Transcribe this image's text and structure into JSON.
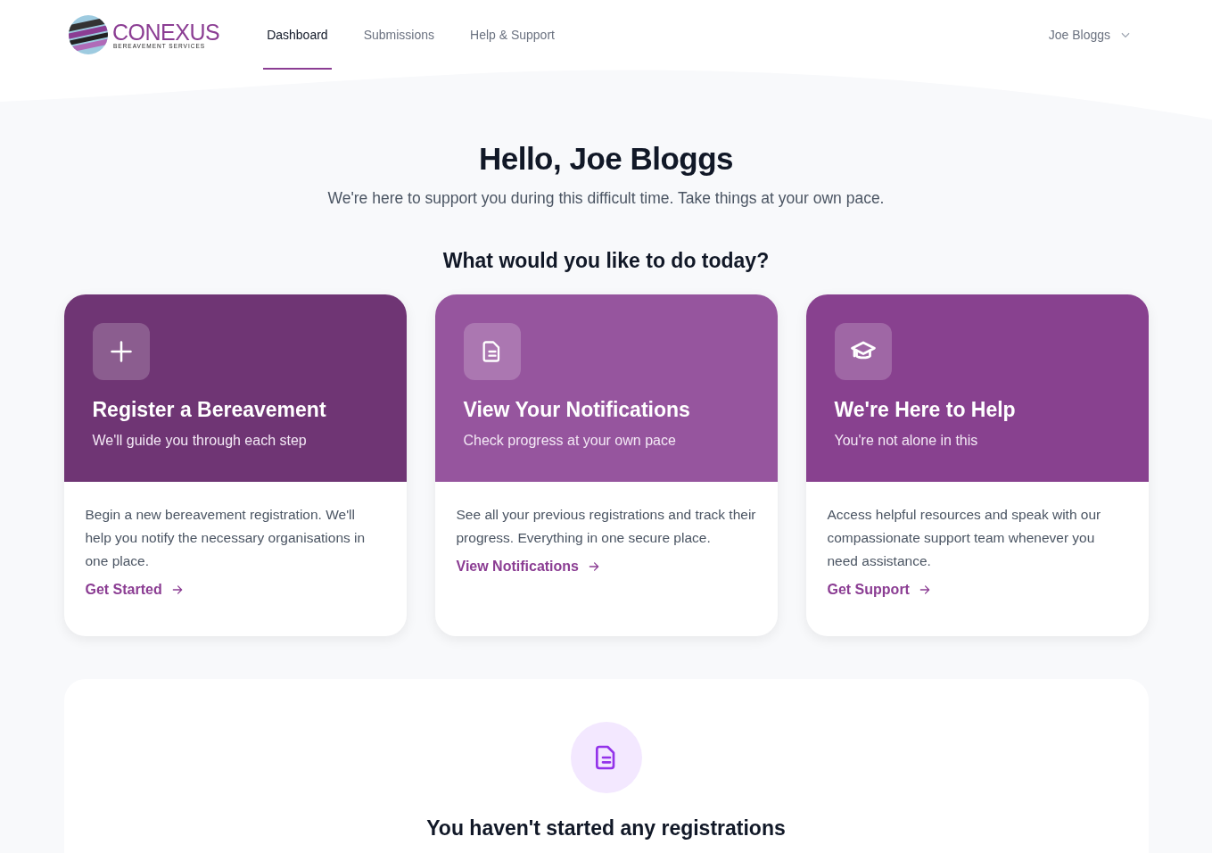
{
  "brand": {
    "name": "CONEXUS",
    "tagline": "BEREAVEMENT SERVICES"
  },
  "nav": [
    {
      "label": "Dashboard",
      "selected": true
    },
    {
      "label": "Submissions",
      "selected": false
    },
    {
      "label": "Help & Support",
      "selected": false
    }
  ],
  "user_menu": {
    "name": "Joe Bloggs"
  },
  "greeting": {
    "title": "Hello, Joe Bloggs",
    "subtitle": "We're here to support you during this difficult time. Take things at your own pace."
  },
  "section_title": "What would you like to do today?",
  "cards": [
    {
      "kind": "plus",
      "color": "#6f3574",
      "title": "Register a Bereavement",
      "subtitle": "We'll guide you through each step",
      "description": "Begin a new bereavement registration. We'll help you notify the necessary organisations in one place.",
      "link": "Get Started"
    },
    {
      "kind": "file",
      "color": "#96559e",
      "title": "View Your Notifications",
      "subtitle": "Check progress at your own pace",
      "description": "See all your previous registrations and track their progress. Everything in one secure place.",
      "link": "View Notifications"
    },
    {
      "kind": "cap",
      "color": "#88418f",
      "title": "We're Here to Help",
      "subtitle": "You're not alone in this",
      "description": "Access helpful resources and speak with our compassionate support team whenever you need assistance.",
      "link": "Get Support"
    }
  ],
  "empty_state": {
    "title": "You haven't started any registrations"
  }
}
